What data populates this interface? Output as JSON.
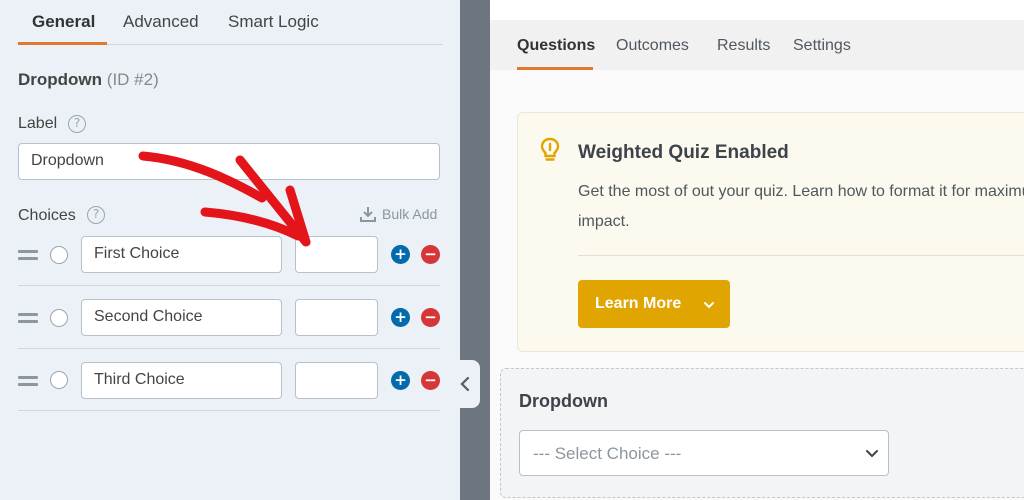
{
  "left": {
    "tabs": [
      {
        "label": "General",
        "active": true
      },
      {
        "label": "Advanced",
        "active": false
      },
      {
        "label": "Smart Logic",
        "active": false
      }
    ],
    "field_name": "Dropdown",
    "field_id": "(ID #2)",
    "label_heading": "Label",
    "label_value": "Dropdown",
    "choices_heading": "Choices",
    "bulk_add": "Bulk Add",
    "choices": [
      {
        "label": "First Choice",
        "value": ""
      },
      {
        "label": "Second Choice",
        "value": ""
      },
      {
        "label": "Third Choice",
        "value": ""
      }
    ],
    "help_glyph": "?",
    "add_glyph": "+",
    "remove_glyph": "−"
  },
  "right": {
    "tabs": [
      {
        "label": "Questions",
        "active": true
      },
      {
        "label": "Outcomes",
        "active": false
      },
      {
        "label": "Results",
        "active": false
      },
      {
        "label": "Settings",
        "active": false
      }
    ],
    "notice": {
      "title": "Weighted Quiz Enabled",
      "body": "Get the most of out your quiz. Learn how to format it for maximum impact.",
      "button": "Learn More"
    },
    "preview": {
      "label": "Dropdown",
      "placeholder": "--- Select Choice ---"
    }
  },
  "colors": {
    "accent": "#e27730",
    "add": "#036aab",
    "remove": "#d63638",
    "button": "#e0a500",
    "annotation": "#e4141b"
  },
  "icons": [
    "help-icon",
    "download-icon",
    "drag-handle-icon",
    "add-icon",
    "remove-icon",
    "chevron-left-icon",
    "lightbulb-icon",
    "chevron-down-icon"
  ]
}
